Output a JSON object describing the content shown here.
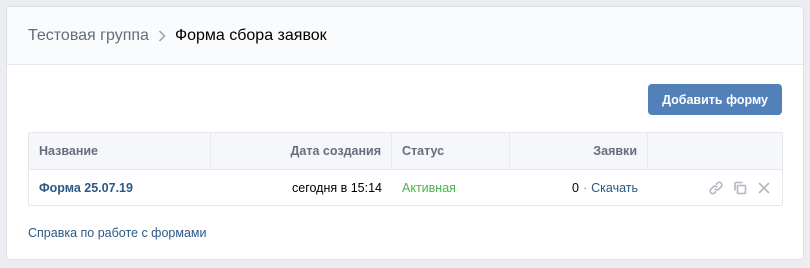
{
  "breadcrumb": {
    "parent": "Тестовая группа",
    "current": "Форма сбора заявок"
  },
  "toolbar": {
    "add_form_label": "Добавить форму"
  },
  "table": {
    "columns": [
      "Название",
      "Дата создания",
      "Статус",
      "Заявки",
      ""
    ],
    "rows": [
      {
        "name": "Форма 25.07.19",
        "created": "сегодня в 15:14",
        "status": "Активная",
        "count": "0",
        "separator": "·",
        "download": "Скачать"
      }
    ]
  },
  "footer": {
    "help_link": "Справка по работе с формами"
  },
  "icons": {
    "breadcrumb_separator": "chevron-right-icon",
    "row_actions": [
      "link-icon",
      "copy-icon",
      "close-icon"
    ]
  },
  "colors": {
    "accent": "#5181b8",
    "link": "#2a5885",
    "status_active": "#4bb34b",
    "icon": "#aeb7c2"
  }
}
